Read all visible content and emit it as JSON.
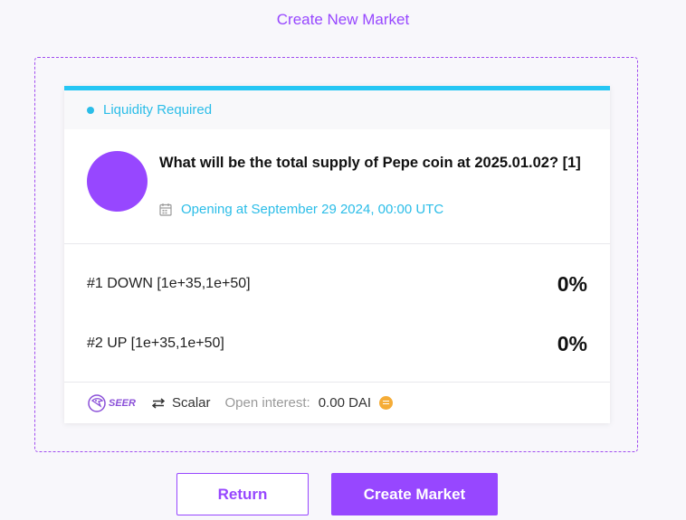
{
  "page": {
    "title": "Create New Market"
  },
  "card": {
    "status_label": "Liquidity Required",
    "question": "What will be the total supply of Pepe coin at 2025.01.02? [1]",
    "opening": "Opening at September 29 2024, 00:00 UTC",
    "outcomes": [
      {
        "label": "#1 DOWN [1e+35,1e+50]",
        "percent": "0%"
      },
      {
        "label": "#2 UP [1e+35,1e+50]",
        "percent": "0%"
      }
    ],
    "footer": {
      "brand": "SEER",
      "market_type": "Scalar",
      "open_interest_label": "Open interest:",
      "open_interest_value": "0.00 DAI"
    }
  },
  "actions": {
    "return_label": "Return",
    "create_label": "Create Market"
  },
  "colors": {
    "accent": "#9747ff",
    "info": "#2bbde8",
    "status_bar": "#26c6f4",
    "dai": "#f5ac37"
  },
  "icons": {
    "date": "calendar-icon",
    "type": "scalar-arrows-icon",
    "currency": "dai-coin-icon"
  }
}
